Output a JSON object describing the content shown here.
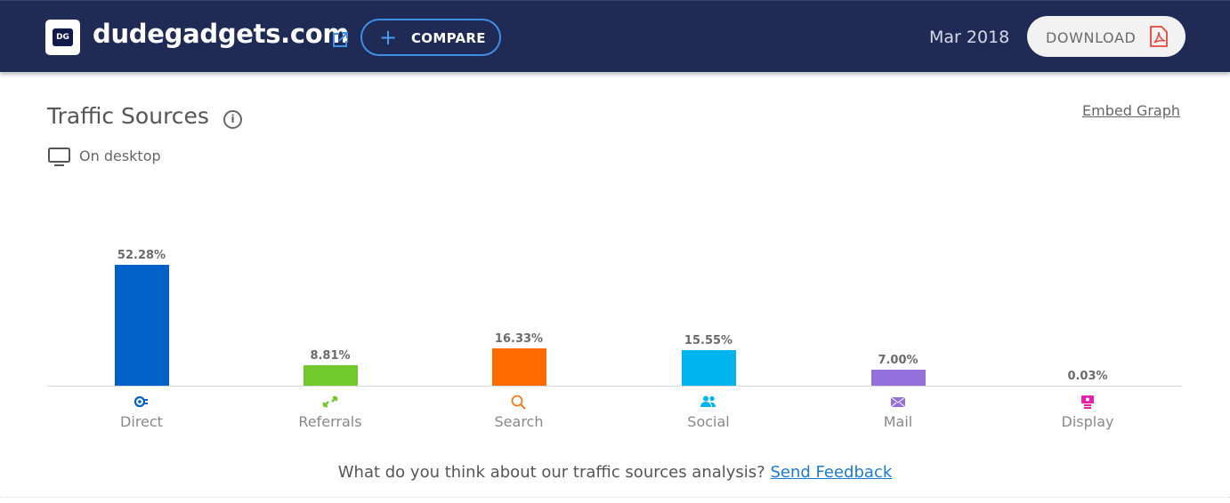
{
  "header": {
    "logo_text": "DG",
    "site_name": "dudegadgets.com",
    "compare_label": "COMPARE",
    "date": "Mar 2018",
    "download_label": "DOWNLOAD"
  },
  "section": {
    "title": "Traffic Sources",
    "info_glyph": "i",
    "embed_label": "Embed Graph",
    "device_label": "On desktop"
  },
  "chart_data": {
    "type": "bar",
    "title": "Traffic Sources",
    "xlabel": "",
    "ylabel": "",
    "ylim": [
      0,
      100
    ],
    "categories": [
      "Direct",
      "Referrals",
      "Search",
      "Social",
      "Mail",
      "Display"
    ],
    "values": [
      52.28,
      8.81,
      16.33,
      15.55,
      7.0,
      0.03
    ],
    "value_labels": [
      "52.28%",
      "8.81%",
      "16.33%",
      "15.55%",
      "7.00%",
      "0.03%"
    ],
    "colors": [
      "#0061c9",
      "#72c92e",
      "#ff6a00",
      "#00b4ef",
      "#9370db",
      "#e91eb0"
    ],
    "icons": [
      "direct-icon",
      "referrals-icon",
      "search-icon",
      "social-icon",
      "mail-icon",
      "display-icon"
    ],
    "grid": false,
    "legend": "none"
  },
  "footer": {
    "question": "What do you think about our traffic sources analysis?",
    "feedback_link": "Send Feedback"
  }
}
